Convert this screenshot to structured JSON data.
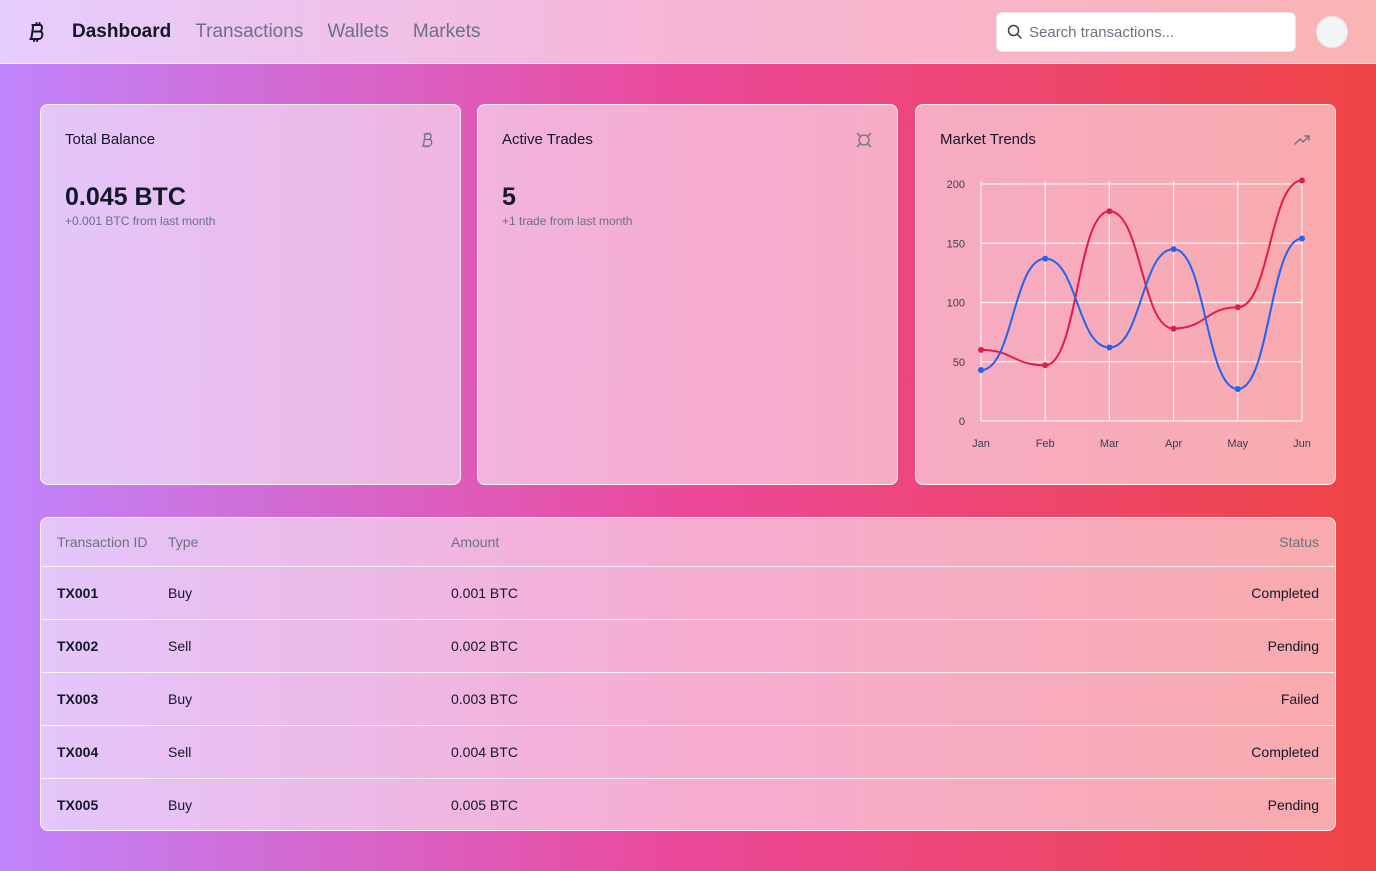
{
  "nav": {
    "logo_icon": "bitcoin-icon",
    "items": [
      {
        "label": "Dashboard",
        "active": true
      },
      {
        "label": "Transactions",
        "active": false
      },
      {
        "label": "Wallets",
        "active": false
      },
      {
        "label": "Markets",
        "active": false
      }
    ]
  },
  "search": {
    "placeholder": "Search transactions...",
    "value": ""
  },
  "cards": {
    "balance": {
      "title": "Total Balance",
      "value": "0.045 BTC",
      "sub": "+0.001 BTC from last month",
      "icon": "bitcoin-icon"
    },
    "trades": {
      "title": "Active Trades",
      "value": "5",
      "sub": "+1 trade from last month",
      "icon": "currency-icon"
    },
    "trends": {
      "title": "Market Trends",
      "icon": "trending-up-icon"
    }
  },
  "chart_data": {
    "type": "line",
    "x": [
      "Jan",
      "Feb",
      "Mar",
      "Apr",
      "May",
      "Jun"
    ],
    "ylim": [
      0,
      200
    ],
    "yticks": [
      0,
      50,
      100,
      150,
      200
    ],
    "grid": true,
    "series": [
      {
        "values": [
          60,
          47,
          177,
          78,
          96,
          203
        ],
        "color": "#e11d48"
      },
      {
        "values": [
          43,
          137,
          62,
          145,
          27,
          154
        ],
        "color": "#2563eb"
      }
    ]
  },
  "table": {
    "headers": {
      "id": "Transaction ID",
      "type": "Type",
      "amount": "Amount",
      "status": "Status"
    },
    "rows": [
      {
        "id": "TX001",
        "type": "Buy",
        "amount": "0.001 BTC",
        "status": "Completed"
      },
      {
        "id": "TX002",
        "type": "Sell",
        "amount": "0.002 BTC",
        "status": "Pending"
      },
      {
        "id": "TX003",
        "type": "Buy",
        "amount": "0.003 BTC",
        "status": "Failed"
      },
      {
        "id": "TX004",
        "type": "Sell",
        "amount": "0.004 BTC",
        "status": "Completed"
      },
      {
        "id": "TX005",
        "type": "Buy",
        "amount": "0.005 BTC",
        "status": "Pending"
      }
    ]
  }
}
